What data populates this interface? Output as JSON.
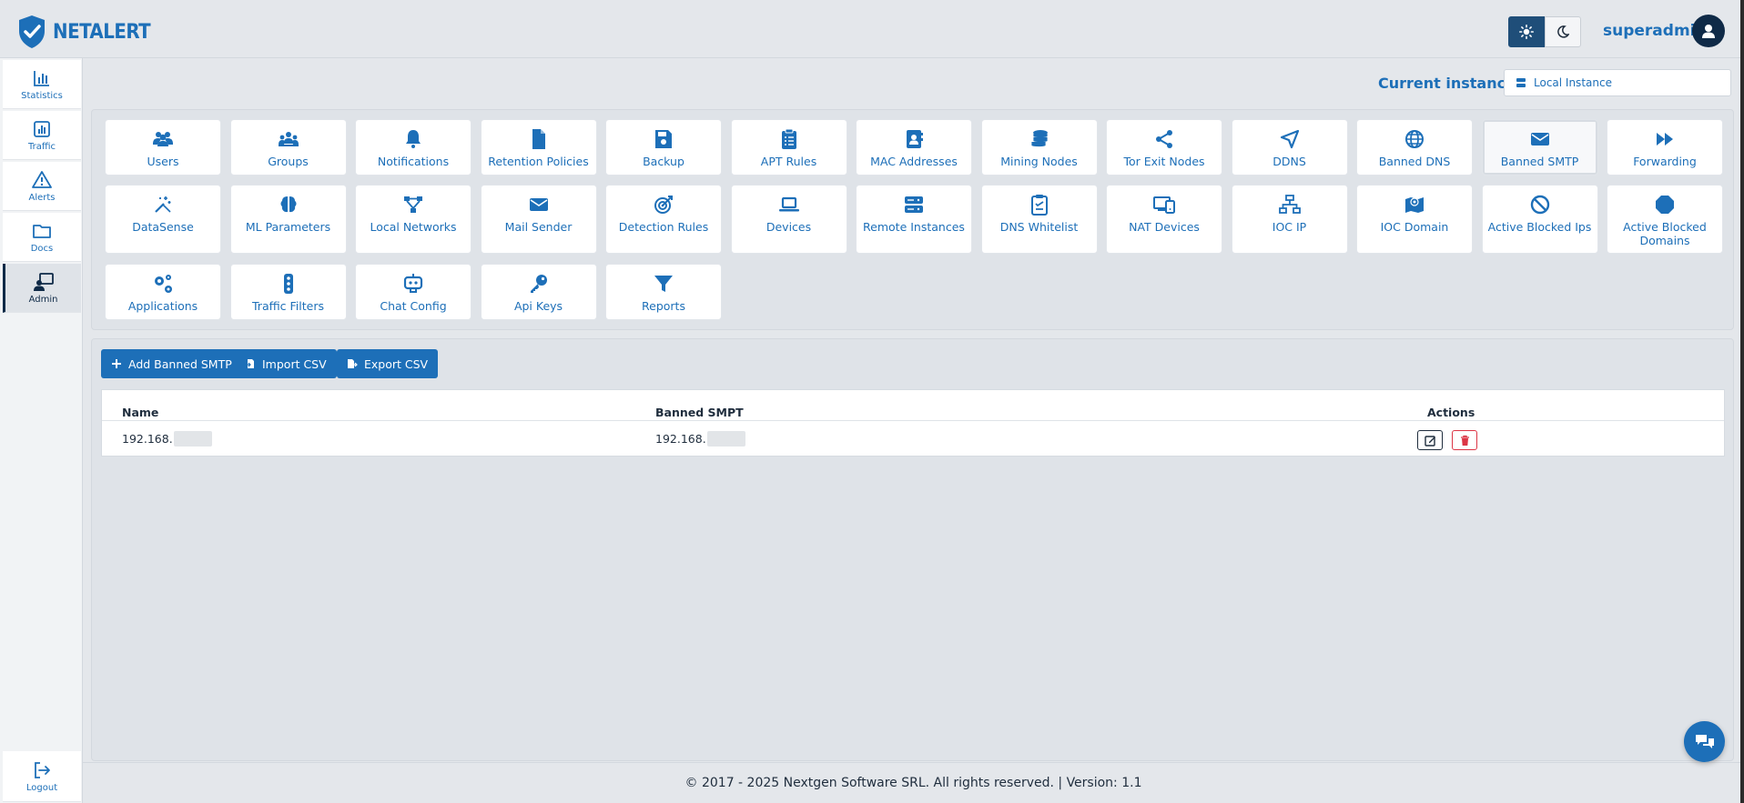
{
  "brand": {
    "name": "NETALERT"
  },
  "header": {
    "username": "superadmin"
  },
  "sidebar": {
    "items": [
      {
        "label": "Statistics",
        "icon": "bar-chart-icon"
      },
      {
        "label": "Traffic",
        "icon": "traffic-chart-icon"
      },
      {
        "label": "Alerts",
        "icon": "warning-icon"
      },
      {
        "label": "Docs",
        "icon": "folder-icon"
      },
      {
        "label": "Admin",
        "icon": "admin-icon",
        "active": true
      }
    ],
    "logout": "Logout"
  },
  "instance": {
    "label": "Current instance:",
    "value": "Local Instance"
  },
  "tiles": [
    {
      "label": "Users",
      "icon": "users-icon"
    },
    {
      "label": "Groups",
      "icon": "groups-icon"
    },
    {
      "label": "Notifications",
      "icon": "bell-icon"
    },
    {
      "label": "Retention Policies",
      "icon": "file-icon"
    },
    {
      "label": "Backup",
      "icon": "floppy-icon"
    },
    {
      "label": "APT Rules",
      "icon": "clipboard-icon"
    },
    {
      "label": "MAC Addresses",
      "icon": "address-book-icon"
    },
    {
      "label": "Mining Nodes",
      "icon": "coins-icon"
    },
    {
      "label": "Tor Exit Nodes",
      "icon": "share-icon"
    },
    {
      "label": "DDNS",
      "icon": "location-arrow-icon"
    },
    {
      "label": "Banned DNS",
      "icon": "globe-icon"
    },
    {
      "label": "Banned SMTP",
      "icon": "envelope-icon",
      "selected": true
    },
    {
      "label": "Forwarding",
      "icon": "forward-icon"
    },
    {
      "label": "DataSense",
      "icon": "wand-icon"
    },
    {
      "label": "ML Parameters",
      "icon": "brain-icon"
    },
    {
      "label": "Local Networks",
      "icon": "network-icon"
    },
    {
      "label": "Mail Sender",
      "icon": "envelope-icon"
    },
    {
      "label": "Detection Rules",
      "icon": "target-icon"
    },
    {
      "label": "Devices",
      "icon": "laptop-icon"
    },
    {
      "label": "Remote Instances",
      "icon": "server-icon"
    },
    {
      "label": "DNS Whitelist",
      "icon": "clipboard-check-icon"
    },
    {
      "label": "NAT Devices",
      "icon": "devices-icon"
    },
    {
      "label": "IOC IP",
      "icon": "sitemap-icon"
    },
    {
      "label": "IOC Domain",
      "icon": "map-pin-icon"
    },
    {
      "label": "Active Blocked Ips",
      "icon": "ban-icon"
    },
    {
      "label": "Active Blocked Domains",
      "icon": "stop-icon"
    },
    {
      "label": "Applications",
      "icon": "cogs-icon"
    },
    {
      "label": "Traffic Filters",
      "icon": "traffic-light-icon"
    },
    {
      "label": "Chat Config",
      "icon": "robot-icon"
    },
    {
      "label": "Api Keys",
      "icon": "key-icon"
    },
    {
      "label": "Reports",
      "icon": "filter-icon"
    }
  ],
  "actions": {
    "add": "Add Banned SMTP",
    "import": "Import CSV",
    "export": "Export CSV"
  },
  "table": {
    "headers": [
      "Name",
      "Banned SMPT",
      "Actions"
    ],
    "rows": [
      {
        "name": "192.168.",
        "banned": "192.168."
      }
    ]
  },
  "footer": "© 2017 - 2025 Nextgen Software SRL. All rights reserved. | Version: 1.1",
  "colors": {
    "accent": "#1d6fb8",
    "dark": "#0f2a47",
    "danger": "#dc3545"
  }
}
